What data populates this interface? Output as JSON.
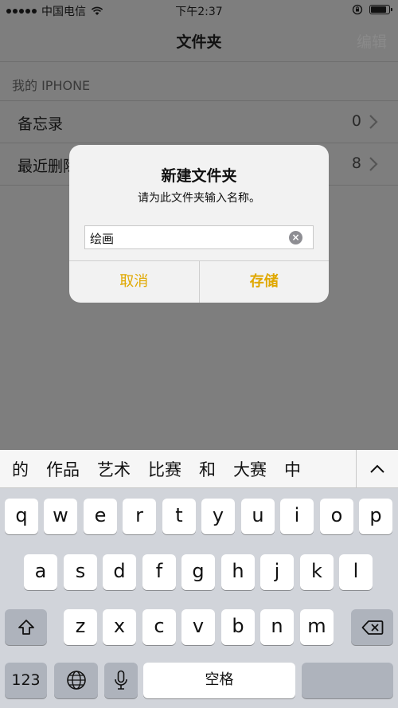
{
  "status_bar": {
    "carrier": "中国电信",
    "time": "下午2:37"
  },
  "nav": {
    "title": "文件夹",
    "edit": "编辑"
  },
  "section_header": "我的 IPHONE",
  "folders": [
    {
      "label": "备忘录",
      "count": "0"
    },
    {
      "label": "最近删除",
      "count": "8"
    }
  ],
  "alert": {
    "title": "新建文件夹",
    "message": "请为此文件夹输入名称。",
    "field_value": "绘画",
    "cancel": "取消",
    "save": "存储"
  },
  "keyboard": {
    "suggestions": [
      "的",
      "作品",
      "艺术",
      "比赛",
      "和",
      "大赛",
      "中"
    ],
    "row1": [
      "q",
      "w",
      "e",
      "r",
      "t",
      "y",
      "u",
      "i",
      "o",
      "p"
    ],
    "row2": [
      "a",
      "s",
      "d",
      "f",
      "g",
      "h",
      "j",
      "k",
      "l"
    ],
    "row3": [
      "z",
      "x",
      "c",
      "v",
      "b",
      "n",
      "m"
    ],
    "num_key": "123",
    "space": "空格"
  },
  "colors": {
    "accent": "#e0a800",
    "dim_overlay": "#7e7e7e",
    "keyboard_bg": "#d1d4da"
  }
}
